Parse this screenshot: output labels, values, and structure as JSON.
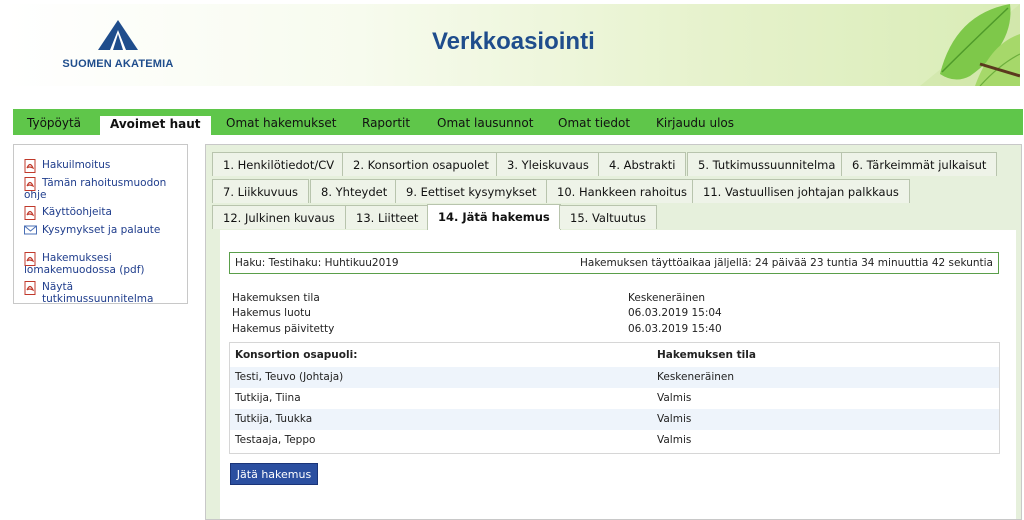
{
  "header": {
    "logo_text": "SUOMEN AKATEMIA",
    "title": "Verkkoasiointi"
  },
  "topnav": {
    "items": [
      {
        "label": "Työpöytä"
      },
      {
        "label": "Avoimet haut"
      },
      {
        "label": "Omat hakemukset"
      },
      {
        "label": "Raportit"
      },
      {
        "label": "Omat lausunnot"
      },
      {
        "label": "Omat tiedot"
      },
      {
        "label": "Kirjaudu ulos"
      }
    ],
    "active_index": 1,
    "color": "#5fc64a"
  },
  "sidebar": {
    "links": [
      {
        "label": "Hakuilmoitus",
        "icon": "pdf-icon"
      },
      {
        "label": "Tämän rahoitusmuodon ohje",
        "icon": "pdf-icon"
      },
      {
        "label": "Käyttöohjeita",
        "icon": "pdf-icon"
      },
      {
        "label": "Kysymykset ja palaute",
        "icon": "mail-icon"
      },
      {
        "label": "Hakemuksesi lomakemuodossa (pdf)",
        "icon": "pdf-icon"
      },
      {
        "label": "Näytä tutkimussuunnitelma",
        "icon": "pdf-icon"
      }
    ]
  },
  "tabs": [
    {
      "label": "1. Henkilötiedot/CV"
    },
    {
      "label": "2. Konsortion osapuolet"
    },
    {
      "label": "3. Yleiskuvaus"
    },
    {
      "label": "4. Abstrakti"
    },
    {
      "label": "5. Tutkimussuunnitelma"
    },
    {
      "label": "6. Tärkeimmät julkaisut"
    },
    {
      "label": "7. Liikkuvuus"
    },
    {
      "label": "8. Yhteydet"
    },
    {
      "label": "9. Eettiset kysymykset"
    },
    {
      "label": "10. Hankkeen rahoitus"
    },
    {
      "label": "11. Vastuullisen johtajan palkkaus"
    },
    {
      "label": "12. Julkinen kuvaus"
    },
    {
      "label": "13. Liitteet"
    },
    {
      "label": "14. Jätä hakemus"
    },
    {
      "label": "15. Valtuutus"
    }
  ],
  "active_tab": "14. Jätä hakemus",
  "haku": {
    "left": "Haku: Testihaku: Huhtikuu2019",
    "right": "Hakemuksen täyttöaikaa jäljellä: 24 päivää 23 tuntia 34 minuuttia 42 sekuntia"
  },
  "info": [
    {
      "label": "Hakemuksen tila",
      "value": "Keskeneräinen"
    },
    {
      "label": "Hakemus luotu",
      "value": "06.03.2019 15:04"
    },
    {
      "label": "Hakemus päivitetty",
      "value": "06.03.2019 15:40"
    }
  ],
  "table": {
    "headers": [
      "Konsortion osapuoli:",
      "Hakemuksen tila"
    ],
    "rows": [
      [
        "Testi, Teuvo (Johtaja)",
        "Keskeneräinen"
      ],
      [
        "Tutkija, Tiina",
        "Valmis"
      ],
      [
        "Tutkija, Tuukka",
        "Valmis"
      ],
      [
        "Testaaja, Teppo",
        "Valmis"
      ]
    ]
  },
  "submit_button": "Jätä hakemus"
}
